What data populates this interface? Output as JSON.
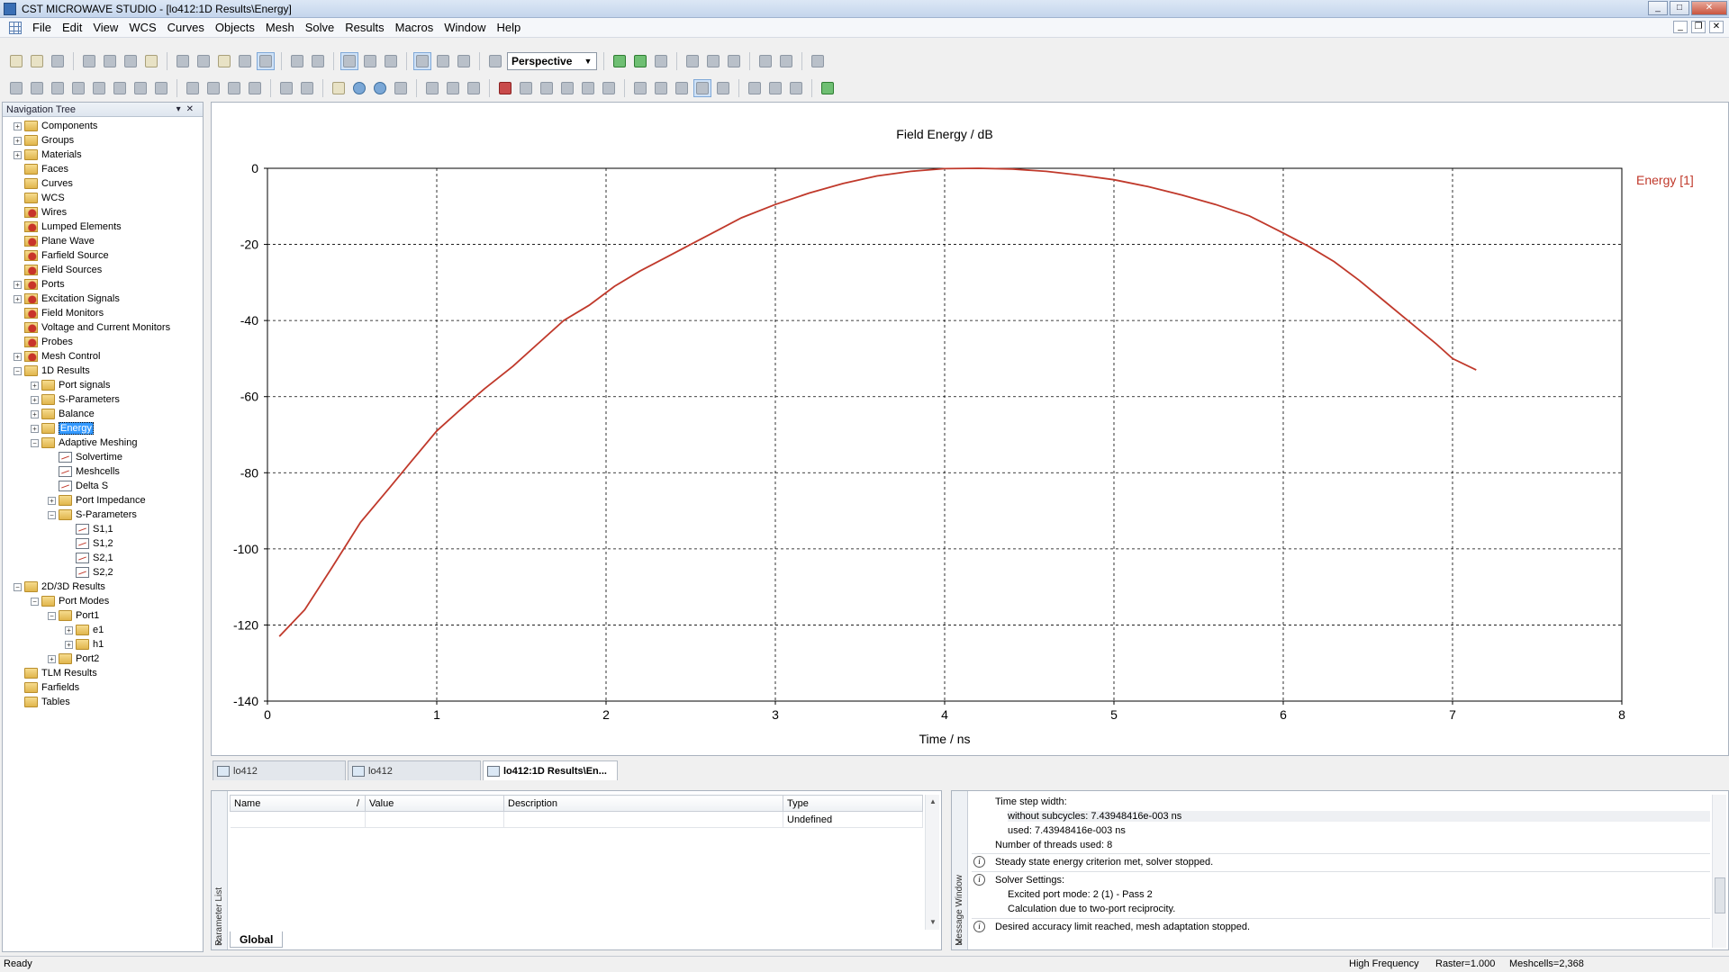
{
  "window": {
    "title": "CST MICROWAVE STUDIO - [lo412:1D Results\\Energy]"
  },
  "menu": [
    "File",
    "Edit",
    "View",
    "WCS",
    "Curves",
    "Objects",
    "Mesh",
    "Solve",
    "Results",
    "Macros",
    "Window",
    "Help"
  ],
  "toolbar": {
    "view_mode": "Perspective"
  },
  "nav_tree": {
    "title": "Navigation Tree",
    "items": [
      {
        "label": "Components",
        "level": 0,
        "exp": "+",
        "icon": "folder-icon"
      },
      {
        "label": "Groups",
        "level": 0,
        "exp": "+",
        "icon": "folder-icon"
      },
      {
        "label": "Materials",
        "level": 0,
        "exp": "+",
        "icon": "folder-icon"
      },
      {
        "label": "Faces",
        "level": 0,
        "exp": "",
        "icon": "folder-icon"
      },
      {
        "label": "Curves",
        "level": 0,
        "exp": "",
        "icon": "folder-icon"
      },
      {
        "label": "WCS",
        "level": 0,
        "exp": "",
        "icon": "folder-icon"
      },
      {
        "label": "Wires",
        "level": 0,
        "exp": "",
        "icon": "gear-folder-icon"
      },
      {
        "label": "Lumped Elements",
        "level": 0,
        "exp": "",
        "icon": "gear-folder-icon"
      },
      {
        "label": "Plane Wave",
        "level": 0,
        "exp": "",
        "icon": "gear-folder-icon"
      },
      {
        "label": "Farfield Source",
        "level": 0,
        "exp": "",
        "icon": "gear-folder-icon"
      },
      {
        "label": "Field Sources",
        "level": 0,
        "exp": "",
        "icon": "gear-folder-icon"
      },
      {
        "label": "Ports",
        "level": 0,
        "exp": "+",
        "icon": "gear-folder-icon"
      },
      {
        "label": "Excitation Signals",
        "level": 0,
        "exp": "+",
        "icon": "gear-folder-icon"
      },
      {
        "label": "Field Monitors",
        "level": 0,
        "exp": "",
        "icon": "gear-folder-icon"
      },
      {
        "label": "Voltage and Current Monitors",
        "level": 0,
        "exp": "",
        "icon": "gear-folder-icon"
      },
      {
        "label": "Probes",
        "level": 0,
        "exp": "",
        "icon": "gear-folder-icon"
      },
      {
        "label": "Mesh Control",
        "level": 0,
        "exp": "+",
        "icon": "gear-folder-icon"
      },
      {
        "label": "1D Results",
        "level": 0,
        "exp": "-",
        "icon": "folder-icon"
      },
      {
        "label": "Port signals",
        "level": 1,
        "exp": "+",
        "icon": "folder-icon"
      },
      {
        "label": "S-Parameters",
        "level": 1,
        "exp": "+",
        "icon": "folder-icon"
      },
      {
        "label": "Balance",
        "level": 1,
        "exp": "+",
        "icon": "folder-icon"
      },
      {
        "label": "Energy",
        "level": 1,
        "exp": "+",
        "icon": "folder-icon",
        "selected": true
      },
      {
        "label": "Adaptive Meshing",
        "level": 1,
        "exp": "-",
        "icon": "folder-icon"
      },
      {
        "label": "Solvertime",
        "level": 2,
        "exp": "",
        "icon": "plot-icon"
      },
      {
        "label": "Meshcells",
        "level": 2,
        "exp": "",
        "icon": "plot-icon"
      },
      {
        "label": "Delta S",
        "level": 2,
        "exp": "",
        "icon": "plot-icon"
      },
      {
        "label": "Port Impedance",
        "level": 2,
        "exp": "+",
        "icon": "folder-icon"
      },
      {
        "label": "S-Parameters",
        "level": 2,
        "exp": "-",
        "icon": "folder-icon"
      },
      {
        "label": "S1,1",
        "level": 3,
        "exp": "",
        "icon": "plot-icon"
      },
      {
        "label": "S1,2",
        "level": 3,
        "exp": "",
        "icon": "plot-icon"
      },
      {
        "label": "S2,1",
        "level": 3,
        "exp": "",
        "icon": "plot-icon"
      },
      {
        "label": "S2,2",
        "level": 3,
        "exp": "",
        "icon": "plot-icon"
      },
      {
        "label": "2D/3D Results",
        "level": 0,
        "exp": "-",
        "icon": "folder-icon"
      },
      {
        "label": "Port Modes",
        "level": 1,
        "exp": "-",
        "icon": "folder-icon"
      },
      {
        "label": "Port1",
        "level": 2,
        "exp": "-",
        "icon": "folder-icon"
      },
      {
        "label": "e1",
        "level": 3,
        "exp": "+",
        "icon": "folder-icon"
      },
      {
        "label": "h1",
        "level": 3,
        "exp": "+",
        "icon": "folder-icon"
      },
      {
        "label": "Port2",
        "level": 2,
        "exp": "+",
        "icon": "folder-icon"
      },
      {
        "label": "TLM Results",
        "level": 0,
        "exp": "",
        "icon": "folder-icon"
      },
      {
        "label": "Farfields",
        "level": 0,
        "exp": "",
        "icon": "folder-icon"
      },
      {
        "label": "Tables",
        "level": 0,
        "exp": "",
        "icon": "folder-icon"
      }
    ]
  },
  "chart_data": {
    "type": "line",
    "title": "Field Energy / dB",
    "xlabel": "Time / ns",
    "ylabel": "",
    "xlim": [
      0,
      8
    ],
    "ylim": [
      -140,
      0
    ],
    "xticks": [
      0,
      1,
      2,
      3,
      4,
      5,
      6,
      7,
      8
    ],
    "yticks": [
      0,
      -20,
      -40,
      -60,
      -80,
      -100,
      -120,
      -140
    ],
    "grid": true,
    "legend_placement": "right",
    "series": [
      {
        "name": "Energy [1]",
        "color": "#c0392b",
        "x": [
          0.07,
          0.22,
          0.38,
          0.55,
          0.72,
          0.85,
          1.0,
          1.15,
          1.28,
          1.45,
          1.6,
          1.75,
          1.9,
          2.05,
          2.2,
          2.35,
          2.5,
          2.65,
          2.8,
          3.0,
          3.2,
          3.4,
          3.6,
          3.8,
          4.0,
          4.2,
          4.4,
          4.6,
          4.8,
          5.0,
          5.2,
          5.4,
          5.6,
          5.8,
          6.0,
          6.15,
          6.3,
          6.45,
          6.6,
          6.75,
          6.9,
          7.0,
          7.14
        ],
        "y": [
          -123,
          -116,
          -105,
          -93,
          -84,
          -77,
          -69,
          -63,
          -58,
          -52,
          -46,
          -40,
          -36,
          -31,
          -27,
          -23.5,
          -20,
          -16.5,
          -13,
          -9.5,
          -6.5,
          -4,
          -2,
          -0.8,
          -0.1,
          0,
          -0.2,
          -0.8,
          -1.8,
          -3,
          -4.8,
          -7,
          -9.5,
          -12.5,
          -17,
          -20.5,
          -24.5,
          -29.5,
          -35,
          -40.5,
          -46,
          -50,
          -53
        ]
      }
    ]
  },
  "doc_tabs": [
    {
      "label": "lo412",
      "active": false
    },
    {
      "label": "lo412",
      "active": false
    },
    {
      "label": "lo412:1D Results\\En...",
      "active": true
    }
  ],
  "param_list": {
    "side_title": "Parameter List",
    "columns": [
      "Name",
      "/",
      "Value",
      "Description",
      "Type"
    ],
    "rows": [
      [
        "",
        "",
        "",
        "Undefined"
      ]
    ],
    "tab_label": "Global"
  },
  "message_window": {
    "side_title": "Message Window",
    "lines": [
      {
        "text": "Time step width:",
        "indent": false,
        "info": false,
        "shade": false
      },
      {
        "text": "without subcycles: 7.43948416e-003 ns",
        "indent": true,
        "info": false,
        "shade": true
      },
      {
        "text": "used: 7.43948416e-003 ns",
        "indent": true,
        "info": false,
        "shade": false
      },
      {
        "text": "Number of threads used: 8",
        "indent": false,
        "info": false,
        "shade": false
      },
      {
        "text": "Steady state energy criterion met, solver stopped.",
        "indent": false,
        "info": true,
        "shade": false
      },
      {
        "text": "Solver Settings:",
        "indent": false,
        "info": true,
        "shade": false
      },
      {
        "text": "Excited port mode: 2 (1) - Pass 2",
        "indent": true,
        "info": false,
        "shade": false
      },
      {
        "text": "Calculation due to two-port reciprocity.",
        "indent": true,
        "info": false,
        "shade": false
      },
      {
        "text": "Desired accuracy limit reached, mesh adaptation stopped.",
        "indent": false,
        "info": true,
        "shade": false
      }
    ]
  },
  "status_bar": {
    "left": "Ready",
    "mode": "High Frequency",
    "raster": "Raster=1.000",
    "meshcells": "Meshcells=2,368"
  }
}
